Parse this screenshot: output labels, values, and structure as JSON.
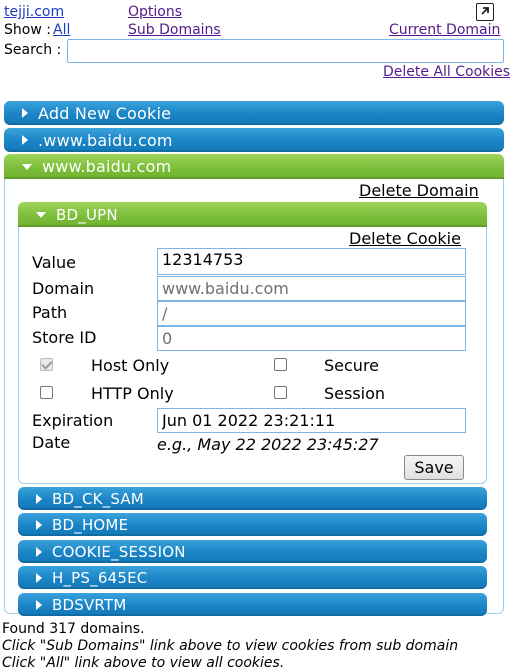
{
  "header": {
    "site_link": "tejji.com",
    "options_link": "Options",
    "show_label": "Show :",
    "all_link": "All",
    "subdomains_link": "Sub Domains",
    "current_domain_link": "Current Domain",
    "search_label": "Search :",
    "search_value": "",
    "delete_all_link": "Delete All Cookies",
    "popout_icon": "external-link-icon"
  },
  "bars": {
    "add_new_cookie": "Add New Cookie",
    "dot_domain": ".www.baidu.com",
    "domain": "www.baidu.com"
  },
  "domain_panel": {
    "delete_domain_link": "Delete Domain",
    "cookie": {
      "name": "BD_UPN",
      "delete_cookie_link": "Delete Cookie",
      "labels": {
        "value": "Value",
        "domain": "Domain",
        "path": "Path",
        "store_id": "Store ID",
        "expiration_1": "Expiration",
        "expiration_2": "Date"
      },
      "fields": {
        "value": "12314753",
        "domain": "www.baidu.com",
        "path": "/",
        "store_id": "0",
        "expiration": "Jun 01 2022 23:21:11"
      },
      "checkboxes": {
        "host_only": "Host Only",
        "secure": "Secure",
        "http_only": "HTTP Only",
        "session": "Session"
      },
      "expiration_hint": "e.g., May 22 2022 23:45:27",
      "save_label": "Save"
    },
    "other_cookies": [
      "BD_CK_SAM",
      "BD_HOME",
      "COOKIE_SESSION",
      "H_PS_645EC",
      "BDSVRTM"
    ]
  },
  "footer": {
    "found": "Found 317 domains.",
    "hint_subdomains": "Click \"Sub Domains\" link above to view cookies from sub domain",
    "hint_all": "Click \"All\" link above to view all cookies."
  },
  "colors": {
    "bar_blue": "#1a84c6",
    "bar_green": "#7cbf3a",
    "link": "#551a8b"
  }
}
